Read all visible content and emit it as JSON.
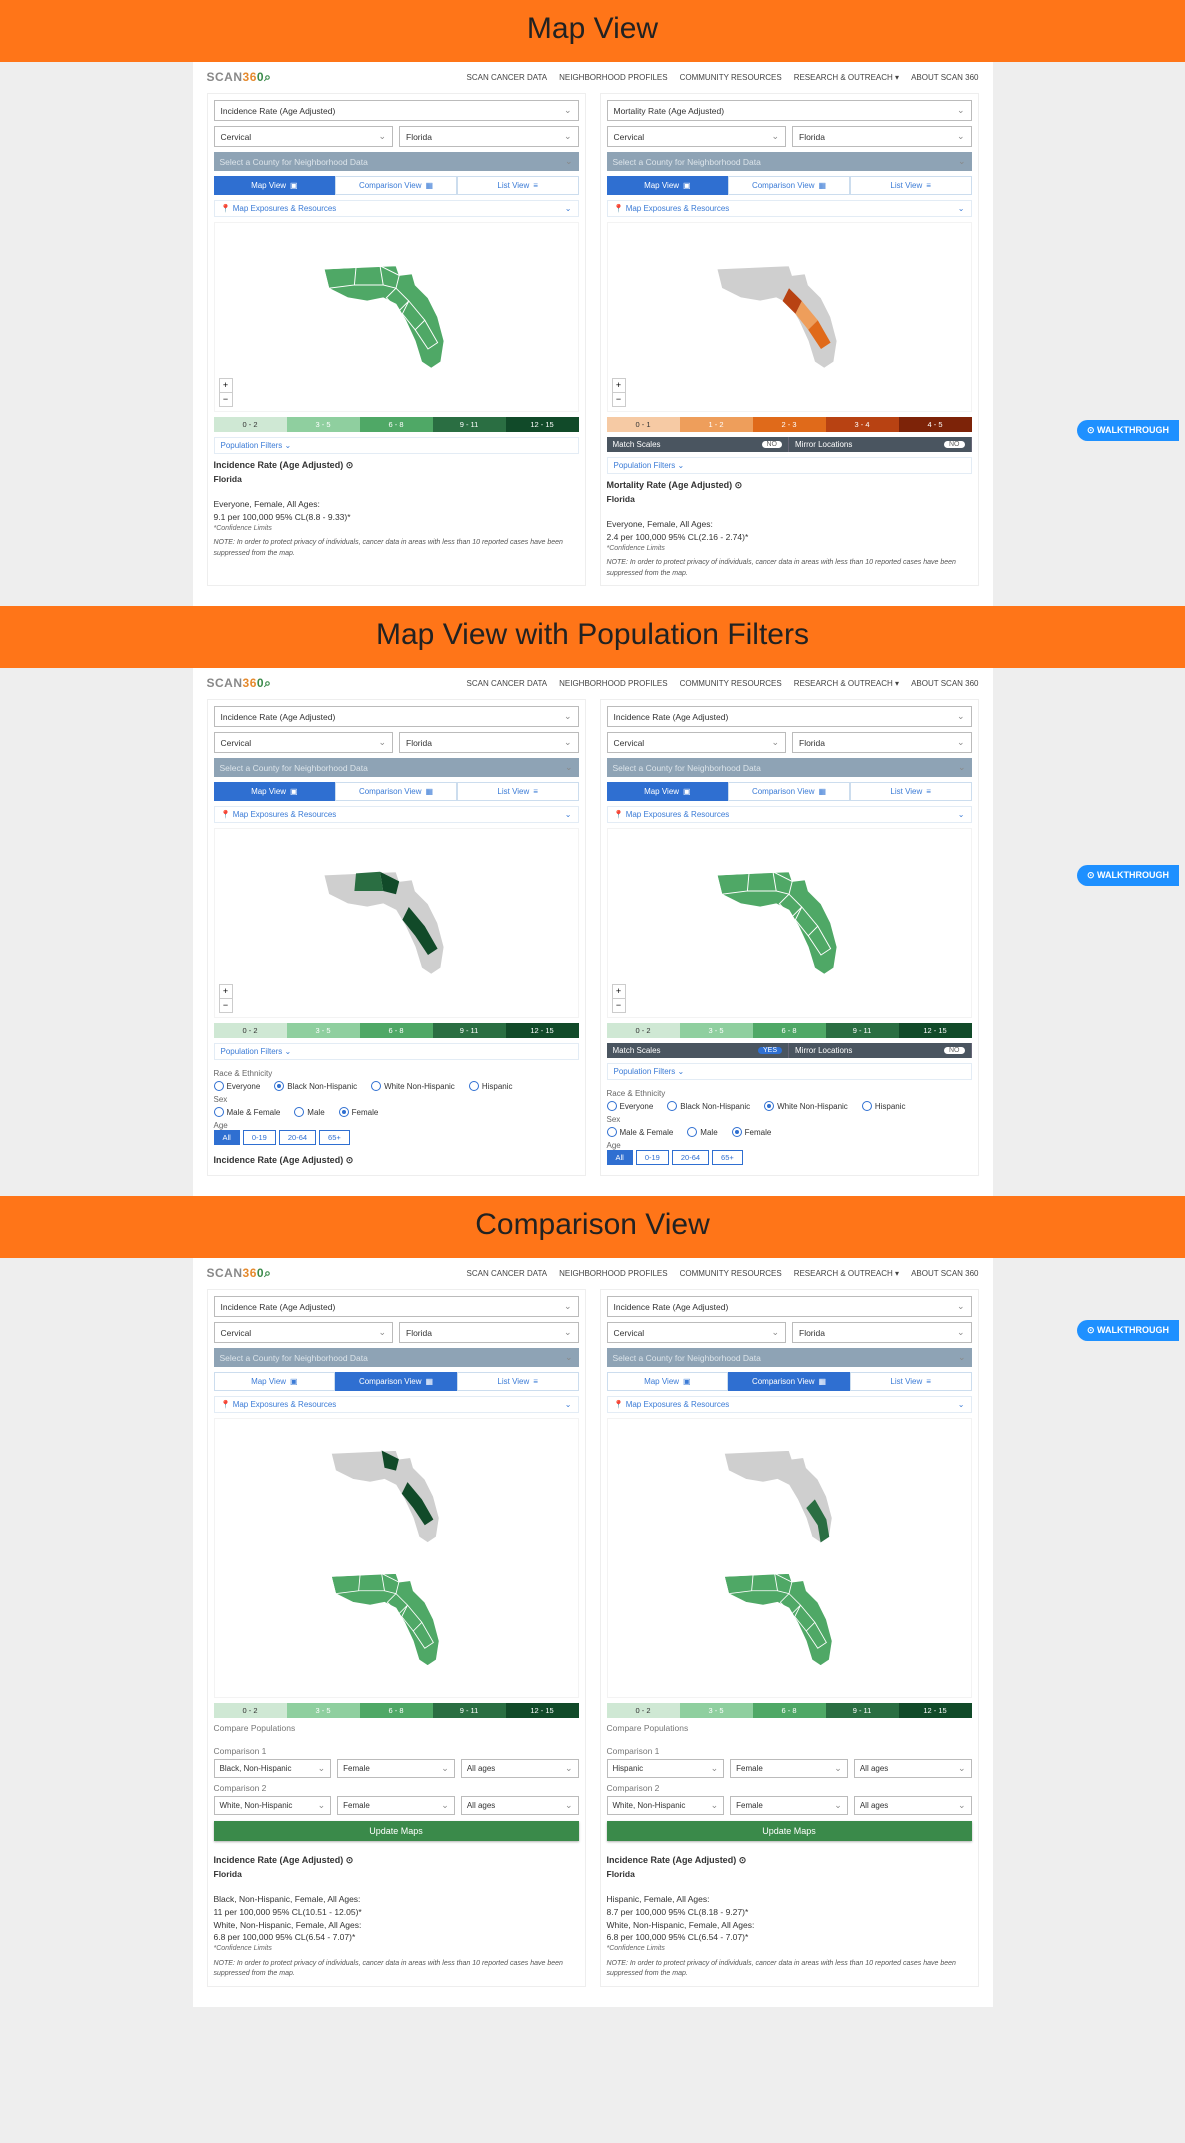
{
  "banners": {
    "b1": "Map View",
    "b2": "Map View with Population Filters",
    "b3": "Comparison View"
  },
  "logo": {
    "part1": "SCAN",
    "part2": "36",
    "part3": "0"
  },
  "nav": [
    "SCAN CANCER DATA",
    "NEIGHBORHOOD PROFILES",
    "COMMUNITY RESOURCES",
    "RESEARCH & OUTREACH ▾",
    "ABOUT SCAN 360"
  ],
  "walkthrough": "⊙ WALKTHROUGH",
  "measure": {
    "incidence": "Incidence Rate (Age Adjusted)",
    "mortality": "Mortality Rate (Age Adjusted)"
  },
  "cancer": "Cervical",
  "region": "Florida",
  "countyPlaceholder": "Select a County for Neighborhood Data",
  "tabs": {
    "map": "Map View",
    "comp": "Comparison View",
    "list": "List View"
  },
  "exposures": "Map Exposures & Resources",
  "popFilters": "Population Filters",
  "comparePop": "Compare Populations",
  "matchScales": "Match Scales",
  "mirrorLoc": "Mirror Locations",
  "no": "NO",
  "yes": "YES",
  "legendGreen": [
    {
      "t": "0 - 2",
      "c": "#cfe8d4"
    },
    {
      "t": "3 - 5",
      "c": "#8fcf9f"
    },
    {
      "t": "6 - 8",
      "c": "#4fa866"
    },
    {
      "t": "9 - 11",
      "c": "#2a6e42"
    },
    {
      "t": "12 - 15",
      "c": "#114a29"
    }
  ],
  "legendOrange": [
    {
      "t": "0 - 1",
      "c": "#f6caa4"
    },
    {
      "t": "1 - 2",
      "c": "#ee9e5b"
    },
    {
      "t": "2 - 3",
      "c": "#e06a1a"
    },
    {
      "t": "3 - 4",
      "c": "#b84212"
    },
    {
      "t": "4 - 5",
      "c": "#7d2308"
    }
  ],
  "stats1L": {
    "title": "Incidence Rate (Age Adjusted) ⊙",
    "region": "Florida",
    "pop": "Everyone, Female, All Ages:",
    "rate": "9.1 per 100,000     95% CL(8.8 - 9.33)*",
    "confLabel": "*Confidence Limits",
    "note": "NOTE: In order to protect privacy of individuals, cancer data in areas with less than 10 reported cases have been suppressed from the map."
  },
  "stats1R": {
    "title": "Mortality Rate (Age Adjusted) ⊙",
    "region": "Florida",
    "pop": "Everyone, Female, All Ages:",
    "rate": "2.4 per 100,000     95% CL(2.16 - 2.74)*",
    "confLabel": "*Confidence Limits",
    "note": "NOTE: In order to protect privacy of individuals, cancer data in areas with less than 10 reported cases have been suppressed from the map."
  },
  "raceEth": "Race & Ethnicity",
  "sex": "Sex",
  "age": "Age",
  "races": {
    "everyone": "Everyone",
    "black": "Black Non-Hispanic",
    "white": "White Non-Hispanic",
    "hisp": "Hispanic"
  },
  "sexes": {
    "mf": "Male & Female",
    "m": "Male",
    "f": "Female"
  },
  "ages": [
    "All",
    "0-19",
    "20-64",
    "65+"
  ],
  "stats2Title": "Incidence Rate (Age Adjusted) ⊙",
  "cmp": {
    "c1": "Comparison 1",
    "c2": "Comparison 2",
    "female": "Female",
    "allAges": "All ages",
    "blackNH": "Black, Non-Hispanic",
    "whiteNH": "White, Non-Hispanic",
    "hispanic": "Hispanic",
    "update": "Update Maps"
  },
  "stats3L": {
    "title": "Incidence Rate (Age Adjusted) ⊙",
    "region": "Florida",
    "pop1": "Black, Non-Hispanic, Female, All Ages:",
    "rate1": "11 per 100,000     95% CL(10.51 - 12.05)*",
    "pop2": "White, Non-Hispanic, Female, All Ages:",
    "rate2": "6.8 per 100,000     95% CL(6.54 - 7.07)*",
    "confLabel": "*Confidence Limits",
    "note": "NOTE: In order to protect privacy of individuals, cancer data in areas with less than 10 reported cases have been suppressed from the map."
  },
  "stats3R": {
    "title": "Incidence Rate (Age Adjusted) ⊙",
    "region": "Florida",
    "pop1": "Hispanic, Female, All Ages:",
    "rate1": "8.7 per 100,000     95% CL(8.18 - 9.27)*",
    "pop2": "White, Non-Hispanic, Female, All Ages:",
    "rate2": "6.8 per 100,000     95% CL(6.54 - 7.07)*",
    "confLabel": "*Confidence Limits",
    "note": "NOTE: In order to protect privacy of individuals, cancer data in areas with less than 10 reported cases have been suppressed from the map."
  }
}
